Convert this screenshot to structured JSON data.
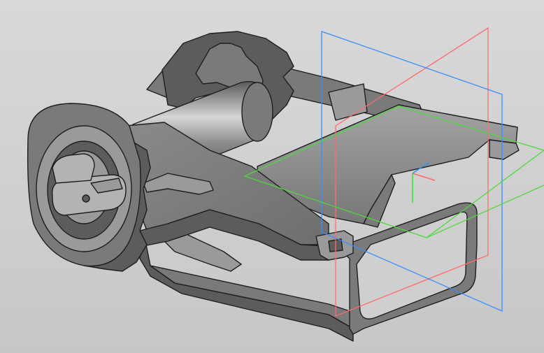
{
  "viewport": {
    "background_top": "#d9d9d9",
    "background_bottom": "#c7c7c7"
  },
  "model": {
    "shade_dark": "#5c5c5c",
    "shade_mid": "#7a7a7a",
    "shade_light": "#9a9a9a",
    "shade_highlight": "#b3b3b3",
    "edge_color": "#1e1e1e"
  },
  "planes": [
    {
      "name": "front-plane",
      "color": "#ff6b6b"
    },
    {
      "name": "right-plane",
      "color": "#3c8dff"
    },
    {
      "name": "top-plane",
      "color": "#4cd93c"
    }
  ],
  "origin_axes": [
    {
      "name": "axis-x",
      "color": "#ff6b6b"
    },
    {
      "name": "axis-y",
      "color": "#4cd93c"
    },
    {
      "name": "axis-z",
      "color": "#3c8dff"
    }
  ]
}
